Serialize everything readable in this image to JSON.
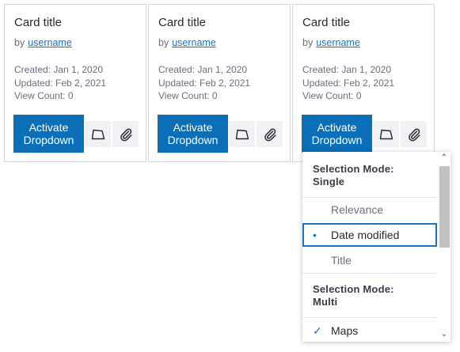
{
  "cards": [
    {
      "title": "Card title",
      "by": "by",
      "username": "username",
      "created": "Created: Jan 1, 2020",
      "updated": "Updated: Feb 2, 2021",
      "views": "View Count: 0",
      "activate_line1": "Activate",
      "activate_line2": "Dropdown"
    },
    {
      "title": "Card title",
      "by": "by",
      "username": "username",
      "created": "Created: Jan 1, 2020",
      "updated": "Updated: Feb 2, 2021",
      "views": "View Count: 0",
      "activate_line1": "Activate",
      "activate_line2": "Dropdown"
    },
    {
      "title": "Card title",
      "by": "by",
      "username": "username",
      "created": "Created: Jan 1, 2020",
      "updated": "Updated: Feb 2, 2021",
      "views": "View Count: 0",
      "activate_line1": "Activate",
      "activate_line2": "Dropdown"
    }
  ],
  "icons": {
    "first_action": "tag-icon",
    "second_action": "paperclip-icon"
  },
  "dropdown": {
    "single_header_line1": "Selection Mode:",
    "single_header_line2": "Single",
    "single_items": [
      {
        "label": "Relevance",
        "selected": false
      },
      {
        "label": "Date modified",
        "selected": true
      },
      {
        "label": "Title",
        "selected": false
      }
    ],
    "multi_header_line1": "Selection Mode:",
    "multi_header_line2": "Multi",
    "multi_items": [
      {
        "label": "Maps",
        "checked": true
      }
    ]
  },
  "colors": {
    "primary": "#0b6fb8",
    "link": "#1a73c2",
    "border": "#d6d6d9"
  }
}
